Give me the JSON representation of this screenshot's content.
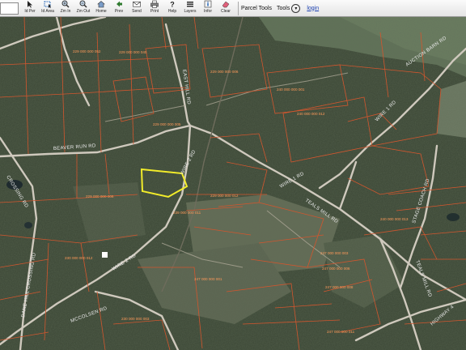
{
  "toolbar": {
    "search_value": "",
    "tools": [
      {
        "name": "id-per-tool",
        "label": "Id Per",
        "icon": "cursor-icon"
      },
      {
        "name": "id-area-tool",
        "label": "Id Area",
        "icon": "id-area-icon"
      },
      {
        "name": "zoom-in-tool",
        "label": "Zm In",
        "icon": "zoom-in-icon"
      },
      {
        "name": "zoom-out-tool",
        "label": "Zm Out",
        "icon": "zoom-out-icon"
      },
      {
        "name": "home-tool",
        "label": "Home",
        "icon": "home-icon"
      },
      {
        "name": "prev-tool",
        "label": "Prev",
        "icon": "back-arrow-icon"
      },
      {
        "name": "send-tool",
        "label": "Send",
        "icon": "envelope-icon"
      },
      {
        "name": "print-tool",
        "label": "Print",
        "icon": "printer-icon"
      },
      {
        "name": "help-tool",
        "label": "Help",
        "icon": "help-icon"
      },
      {
        "name": "layers-tool",
        "label": "Layers",
        "icon": "layers-icon"
      },
      {
        "name": "info-tool",
        "label": "Infor",
        "icon": "info-icon"
      },
      {
        "name": "clear-tool",
        "label": "Clear",
        "icon": "eraser-icon"
      }
    ],
    "parcel_tools": "Parcel Tools",
    "tools_menu": "Tools",
    "login": "login"
  },
  "map": {
    "road_labels": [
      {
        "text": "EAST HILL RD"
      },
      {
        "text": "CROSSING RD"
      },
      {
        "text": "BEAVER RUN RD"
      },
      {
        "text": "WIRE 2 RD"
      },
      {
        "text": "WIRE 1 RD"
      },
      {
        "text": "WIRE 2 RD"
      },
      {
        "text": "WIRE 1 RD"
      },
      {
        "text": "AUCTION BARN RD"
      },
      {
        "text": "TEALS MILL RD"
      },
      {
        "text": "STAGE COACH RD"
      },
      {
        "text": "DANE HILL CROSSING RD"
      },
      {
        "text": "MCCOLSEN RD"
      },
      {
        "text": "TEALS MILL RD"
      },
      {
        "text": "HIGHWAY 4"
      }
    ],
    "parcel_labels": [
      "229 000 000 052",
      "229 000 000 040",
      "229 000 000 006",
      "240 000 000 001",
      "240 000 000 012",
      "229 000 000 005",
      "229 000 000 006",
      "229 000 000 012",
      "239 000 000 011",
      "240 000 000 013",
      "247 000 000 001",
      "247 000 000 003",
      "247 000 000 006",
      "247 000 000 008",
      "247 000 000 011",
      "230 000 000 012",
      "230 000 000 003"
    ]
  },
  "colors": {
    "parcel_line": "#d2562e",
    "selected_parcel": "#f2ec2a",
    "road": "#cfc9bd"
  }
}
